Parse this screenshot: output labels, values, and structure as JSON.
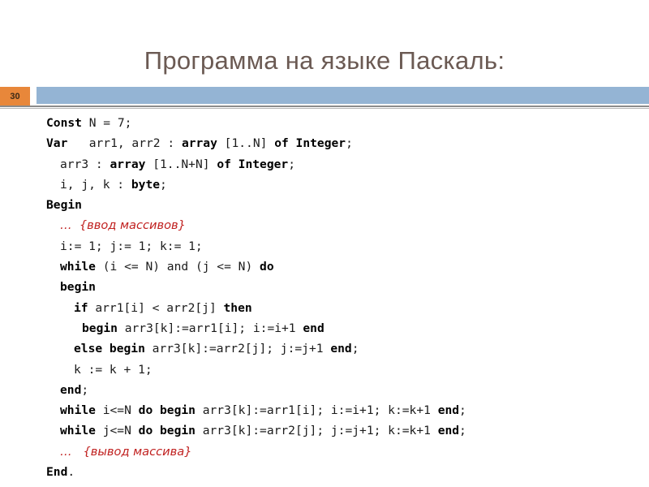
{
  "slide": {
    "title": "Программа на языке Паскаль:",
    "number": "30",
    "title_color": "#6b5a53",
    "badge_color": "#e8873a",
    "band_color": "#94b4d4",
    "comment_color": "#c0201f"
  },
  "code": {
    "language": "Pascal",
    "lines": [
      {
        "id": "line-const",
        "indent": 0,
        "tokens": [
          {
            "t": "Const",
            "style": "keyword"
          },
          {
            "t": " N = 7;",
            "style": "plain"
          }
        ],
        "text": "Const N = 7;"
      },
      {
        "id": "line-var-arr1-arr2",
        "indent": 0,
        "tokens": [
          {
            "t": "Var",
            "style": "keyword"
          },
          {
            "t": "   arr1, arr2 : ",
            "style": "plain"
          },
          {
            "t": "array",
            "style": "keyword"
          },
          {
            "t": " [1..N] ",
            "style": "plain"
          },
          {
            "t": "of Integer",
            "style": "keyword"
          },
          {
            "t": ";",
            "style": "plain"
          }
        ],
        "text": "Var   arr1, arr2 : array [1..N] of Integer;"
      },
      {
        "id": "line-var-arr3",
        "indent": 1,
        "tokens": [
          {
            "t": "arr3 : ",
            "style": "plain"
          },
          {
            "t": "array",
            "style": "keyword"
          },
          {
            "t": " [1..N+N] ",
            "style": "plain"
          },
          {
            "t": "of Integer",
            "style": "keyword"
          },
          {
            "t": ";",
            "style": "plain"
          }
        ],
        "text": "  arr3 : array [1..N+N] of Integer;"
      },
      {
        "id": "line-var-ijk",
        "indent": 1,
        "tokens": [
          {
            "t": "i, j, k : ",
            "style": "plain"
          },
          {
            "t": "byte",
            "style": "keyword"
          },
          {
            "t": ";",
            "style": "plain"
          }
        ],
        "text": "  i, j, k : byte;"
      },
      {
        "id": "line-begin-main",
        "indent": 0,
        "tokens": [
          {
            "t": "Begin",
            "style": "keyword"
          }
        ],
        "text": "Begin"
      },
      {
        "id": "line-comment-input",
        "indent": 1,
        "tokens": [
          {
            "t": "…  {ввод массивов}",
            "style": "comment"
          }
        ],
        "text": "  …  {ввод массивов}"
      },
      {
        "id": "line-init-counters",
        "indent": 1,
        "tokens": [
          {
            "t": "i:= 1; j:= 1; k:= 1;",
            "style": "plain"
          }
        ],
        "text": "  i:= 1; j:= 1; k:= 1;"
      },
      {
        "id": "line-while-main",
        "indent": 1,
        "tokens": [
          {
            "t": "while",
            "style": "keyword"
          },
          {
            "t": " (i <= N) and (j <= N) ",
            "style": "plain"
          },
          {
            "t": "do",
            "style": "keyword"
          }
        ],
        "text": "  while (i <= N) and (j <= N) do"
      },
      {
        "id": "line-begin-loop",
        "indent": 1,
        "tokens": [
          {
            "t": "begin",
            "style": "keyword"
          }
        ],
        "text": "  begin"
      },
      {
        "id": "line-if",
        "indent": 2,
        "tokens": [
          {
            "t": "if",
            "style": "keyword"
          },
          {
            "t": " arr1[i] < arr2[j] ",
            "style": "plain"
          },
          {
            "t": "then",
            "style": "keyword"
          }
        ],
        "text": "    if arr1[i] < arr2[j] then"
      },
      {
        "id": "line-then-branch",
        "indent": 3,
        "tokens": [
          {
            "t": "begin",
            "style": "keyword"
          },
          {
            "t": " arr3[k]:=arr1[i]; i:=i+1 ",
            "style": "plain"
          },
          {
            "t": "end",
            "style": "keyword"
          }
        ],
        "text": "     begin arr3[k]:=arr1[i]; i:=i+1 end"
      },
      {
        "id": "line-else-branch",
        "indent": 2,
        "tokens": [
          {
            "t": "else begin",
            "style": "keyword"
          },
          {
            "t": " arr3[k]:=arr2[j]; j:=j+1 ",
            "style": "plain"
          },
          {
            "t": "end",
            "style": "keyword"
          },
          {
            "t": ";",
            "style": "plain"
          }
        ],
        "text": "    else begin arr3[k]:=arr2[j]; j:=j+1 end;"
      },
      {
        "id": "line-k-increment",
        "indent": 2,
        "tokens": [
          {
            "t": "k := k + 1;",
            "style": "plain"
          }
        ],
        "text": "    k := k + 1;"
      },
      {
        "id": "line-end-loop",
        "indent": 1,
        "tokens": [
          {
            "t": "end",
            "style": "keyword"
          },
          {
            "t": ";",
            "style": "plain"
          }
        ],
        "text": "  end;"
      },
      {
        "id": "line-while-tail-i",
        "indent": 1,
        "tokens": [
          {
            "t": "while",
            "style": "keyword"
          },
          {
            "t": " i<=N ",
            "style": "plain"
          },
          {
            "t": "do begin",
            "style": "keyword"
          },
          {
            "t": " arr3[k]:=arr1[i]; i:=i+1; k:=k+1 ",
            "style": "plain"
          },
          {
            "t": "end",
            "style": "keyword"
          },
          {
            "t": ";",
            "style": "plain"
          }
        ],
        "text": "  while i<=N do begin arr3[k]:=arr1[i]; i:=i+1; k:=k+1 end;"
      },
      {
        "id": "line-while-tail-j",
        "indent": 1,
        "tokens": [
          {
            "t": "while",
            "style": "keyword"
          },
          {
            "t": " j<=N ",
            "style": "plain"
          },
          {
            "t": "do begin",
            "style": "keyword"
          },
          {
            "t": " arr3[k]:=arr2[j]; j:=j+1; k:=k+1 ",
            "style": "plain"
          },
          {
            "t": "end",
            "style": "keyword"
          },
          {
            "t": ";",
            "style": "plain"
          }
        ],
        "text": "  while j<=N do begin arr3[k]:=arr2[j]; j:=j+1; k:=k+1 end;"
      },
      {
        "id": "line-comment-output",
        "indent": 1,
        "tokens": [
          {
            "t": "…   {вывод массива}",
            "style": "comment"
          }
        ],
        "text": "  …   {вывод массива}"
      },
      {
        "id": "line-end-program",
        "indent": 0,
        "tokens": [
          {
            "t": "End",
            "style": "keyword"
          },
          {
            "t": ".",
            "style": "plain"
          }
        ],
        "text": "End."
      }
    ]
  }
}
